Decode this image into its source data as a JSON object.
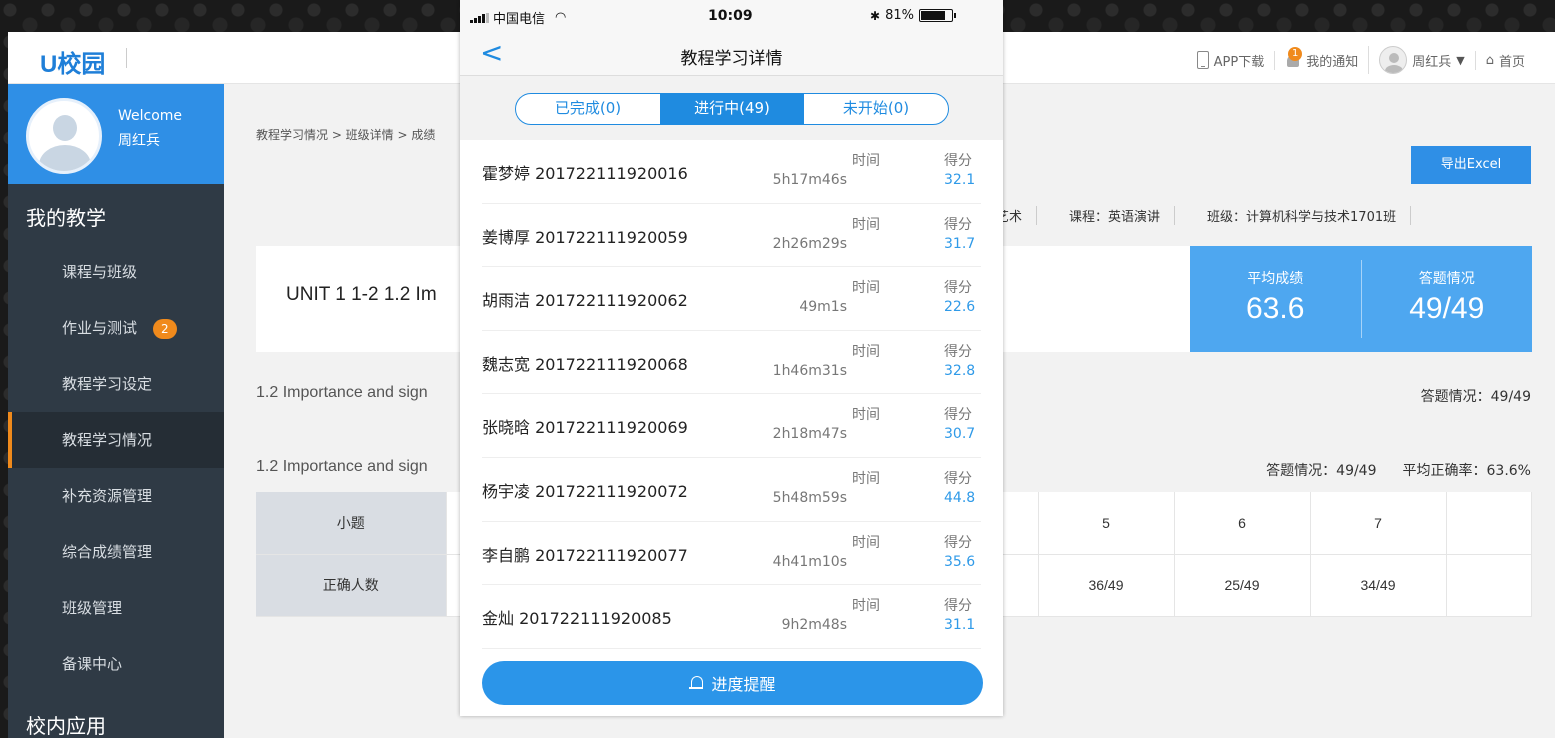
{
  "web": {
    "logo": "U校园",
    "topbar": {
      "app_download": "APP下载",
      "notifications": "我的通知",
      "notification_count": "1",
      "user": "周红兵",
      "user_caret": "▼",
      "home": "首页",
      "home_icon": "home-icon"
    },
    "welcome": {
      "greeting": "Welcome",
      "name": "周红兵"
    },
    "sidebar": {
      "section_teaching": "我的教学",
      "items": [
        {
          "label": "课程与班级"
        },
        {
          "label": "作业与测试",
          "badge": "2"
        },
        {
          "label": "教程学习设定"
        },
        {
          "label": "教程学习情况"
        },
        {
          "label": "补充资源管理"
        },
        {
          "label": "综合成绩管理"
        },
        {
          "label": "班级管理"
        },
        {
          "label": "备课中心"
        }
      ],
      "section_apps": "校内应用"
    },
    "breadcrumb": "教程学习情况 > 班级详情 > 成绩",
    "export_label": "导出Excel",
    "meta": {
      "textbook": "语演讲的艺术",
      "course": "课程：英语演讲",
      "class": "班级：计算机科学与技术1701班"
    },
    "unit_title": "UNIT 1  1-2  1.2 Im",
    "stats": {
      "avg_label": "平均成绩",
      "avg_value": "63.6",
      "answer_label": "答题情况",
      "answer_value": "49/49"
    },
    "line1": "1.2 Importance and sign",
    "line1_right": "答题情况：49/49",
    "line2": "1.2 Importance and sign",
    "line2_right_a": "答题情况：49/49",
    "line2_right_b": "平均正确率：63.6%",
    "table": {
      "row1_head": "小题",
      "row1": [
        "5",
        "6",
        "7",
        ""
      ],
      "row2_head": "正确人数",
      "row2": [
        "36/49",
        "25/49",
        "34/49",
        ""
      ]
    }
  },
  "phone": {
    "status": {
      "carrier": "中国电信",
      "time": "10:09",
      "battery": "81%",
      "battery_level": 0.81
    },
    "title": "教程学习详情",
    "back": "<",
    "tabs": [
      {
        "label": "已完成(0)",
        "active": false
      },
      {
        "label": "进行中(49)",
        "active": true
      },
      {
        "label": "未开始(0)",
        "active": false
      }
    ],
    "time_label": "时间",
    "score_label": "得分",
    "students": [
      {
        "name": "霍梦婷 201722111920016",
        "time": "5h17m46s",
        "score": "32.1"
      },
      {
        "name": "姜博厚 201722111920059",
        "time": "2h26m29s",
        "score": "31.7"
      },
      {
        "name": "胡雨洁 201722111920062",
        "time": "49m1s",
        "score": "22.6"
      },
      {
        "name": "魏志宽 201722111920068",
        "time": "1h46m31s",
        "score": "32.8"
      },
      {
        "name": "张晓晗 201722111920069",
        "time": "2h18m47s",
        "score": "30.7"
      },
      {
        "name": "杨宇凌 201722111920072",
        "time": "5h48m59s",
        "score": "44.8"
      },
      {
        "name": "李自鹏 201722111920077",
        "time": "4h41m10s",
        "score": "35.6"
      },
      {
        "name": "金灿 201722111920085",
        "time": "9h2m48s",
        "score": "31.1"
      }
    ],
    "remind_label": "进度提醒"
  },
  "colors": {
    "accent": "#1f8be0",
    "sidebar": "#2f3a45",
    "active_marker": "#f08a1c"
  }
}
